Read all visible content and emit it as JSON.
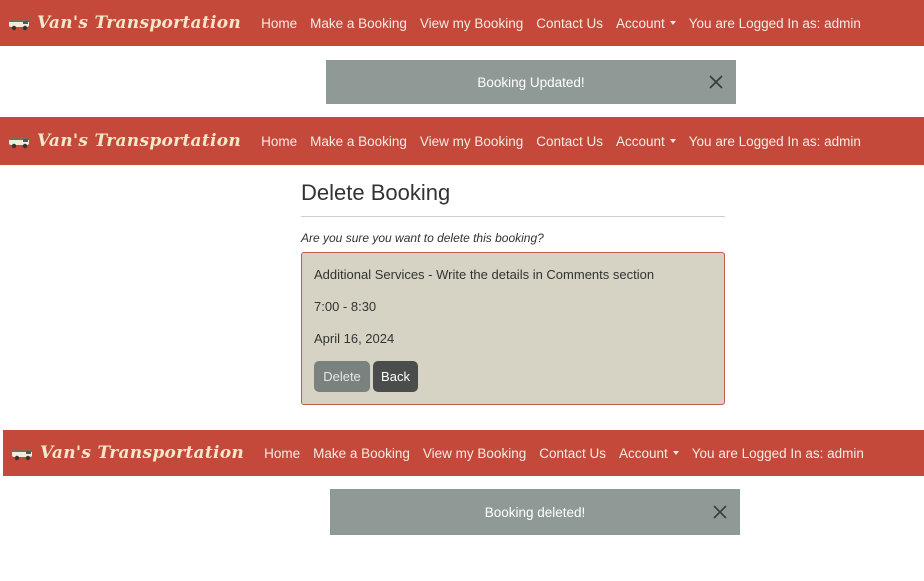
{
  "navbar": {
    "brand": "Van's Transportation",
    "links": {
      "home": "Home",
      "make_booking": "Make a Booking",
      "view_booking": "View my Booking",
      "contact": "Contact Us",
      "account": "Account"
    },
    "logged_in_text": "You are Logged In as: admin"
  },
  "toast_updated": {
    "message": "Booking Updated!"
  },
  "delete_page": {
    "title": "Delete Booking",
    "confirm": "Are you sure you want to delete this booking?",
    "booking": {
      "service": "Additional Services - Write the details in Comments section",
      "time": "7:00 - 8:30",
      "date": "April 16, 2024"
    },
    "delete_button": "Delete",
    "back_button": "Back"
  },
  "toast_deleted": {
    "message": "Booking deleted!"
  },
  "colors": {
    "navbar_bg": "#c4493a",
    "toast_bg": "#8f9a96",
    "card_bg": "#d6d3c4",
    "card_border": "#c65a4a"
  },
  "icons": {
    "logo": "van-icon",
    "close": "close-icon",
    "dropdown": "caret-down-icon"
  }
}
